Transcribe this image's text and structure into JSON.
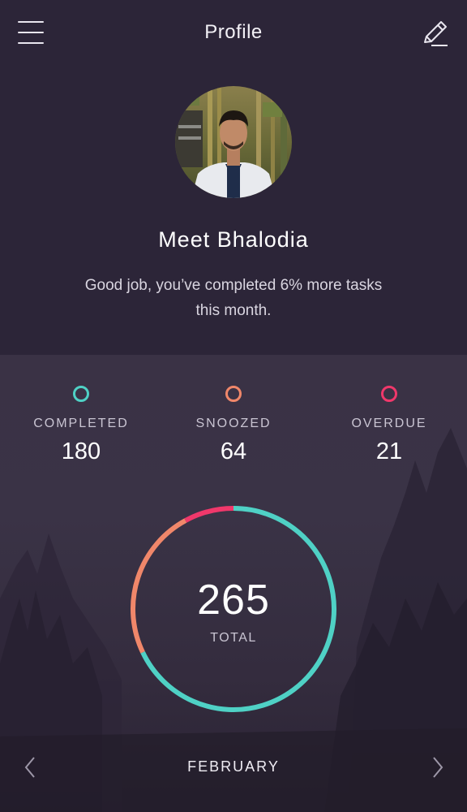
{
  "header": {
    "title": "Profile",
    "menu_icon": "hamburger-menu-icon",
    "edit_icon": "pencil-edit-icon"
  },
  "profile": {
    "name": "Meet Bhalodia",
    "message": "Good job, you’ve completed 6% more tasks this month."
  },
  "stats": [
    {
      "label": "COMPLETED",
      "value": "180",
      "color": "#4fd1c5"
    },
    {
      "label": "SNOOZED",
      "value": "64",
      "color": "#f0876a"
    },
    {
      "label": "OVERDUE",
      "value": "21",
      "color": "#f0386b"
    }
  ],
  "chart_data": {
    "type": "pie",
    "segments": [
      {
        "label": "COMPLETED",
        "value": 180,
        "color": "#4fd1c5"
      },
      {
        "label": "SNOOZED",
        "value": 64,
        "color": "#f0876a"
      },
      {
        "label": "OVERDUE",
        "value": 21,
        "color": "#f0386b"
      }
    ],
    "total": 265
  },
  "summary": {
    "total_value": "265",
    "total_label": "TOTAL"
  },
  "footer": {
    "month": "FEBRUARY",
    "prev_icon": "chevron-left-icon",
    "next_icon": "chevron-right-icon"
  }
}
